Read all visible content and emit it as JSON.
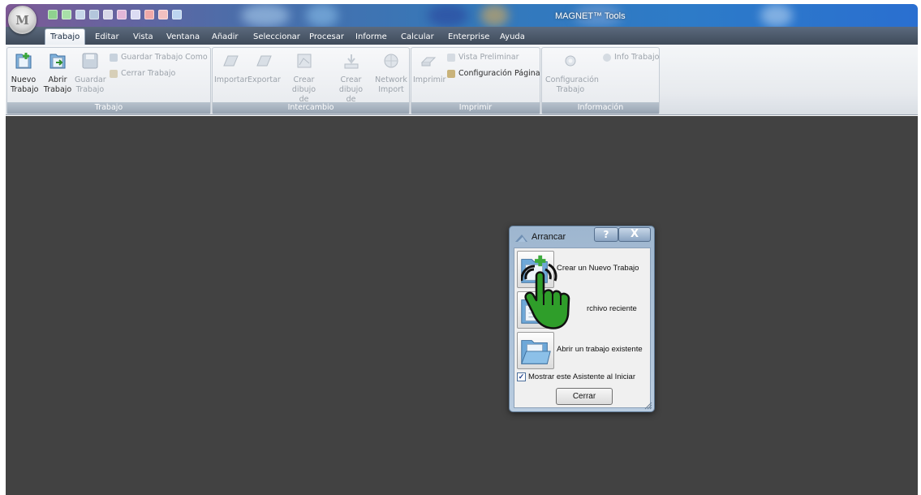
{
  "window": {
    "title": "MAGNET™ Tools"
  },
  "menu": {
    "tabs": [
      "Trabajo",
      "Editar",
      "Vista",
      "Ventana",
      "Añadir",
      "Seleccionar",
      "Procesar",
      "Informe",
      "Calcular",
      "Enterprise",
      "Ayuda"
    ],
    "active": "Trabajo"
  },
  "ribbon": {
    "groups": {
      "trabajo": {
        "title": "Trabajo",
        "nuevo": [
          "Nuevo",
          "Trabajo"
        ],
        "abrir": [
          "Abrir",
          "Trabajo"
        ],
        "guardar": [
          "Guardar",
          "Trabajo"
        ],
        "guardar_como": "Guardar Trabajo Como",
        "cerrar": "Cerrar Trabajo"
      },
      "intercambio": {
        "title": "Intercambio",
        "importar": "Importar",
        "exportar": "Exportar",
        "crear_autocad": [
          "Crear dibujo",
          "de AutoCAD"
        ],
        "crear_magnet": [
          "Crear dibujo",
          "de MAGNET"
        ],
        "network": [
          "Network",
          "Import"
        ]
      },
      "imprimir": {
        "title": "Imprimir",
        "imprimir": "Imprimir",
        "vista_preliminar": "Vista Preliminar",
        "configuracion_pagina": "Configuración Página"
      },
      "informacion": {
        "title": "Información",
        "configuracion": [
          "Configuración",
          "Trabajo"
        ],
        "info": "Info Trabajo"
      }
    }
  },
  "dialog": {
    "title": "Arrancar",
    "help_glyph": "?",
    "close_glyph": "X",
    "options": [
      {
        "label": "Crear un Nuevo Trabajo",
        "icon": "new-job-icon"
      },
      {
        "label": "...archivo reciente",
        "icon": "recent-file-icon"
      },
      {
        "label": "Abrir un trabajo existente",
        "icon": "open-folder-icon"
      }
    ],
    "option2_visible_label": "rchivo reciente",
    "checkbox": {
      "label": "Mostrar este Asistente al Iniciar",
      "checked": true,
      "glyph": "✓"
    },
    "close_button": "Cerrar"
  },
  "app_orb": {
    "letter": "M"
  },
  "colors": {
    "workspace": "#424242",
    "accent": "#2d7bc8",
    "cursor_hand": "#2f9e2a"
  }
}
